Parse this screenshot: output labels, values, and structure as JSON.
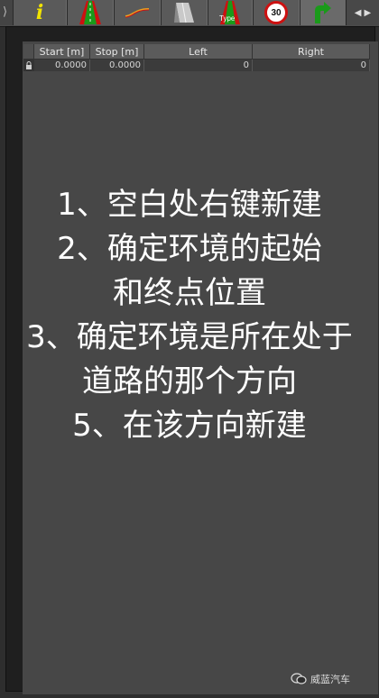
{
  "toolbar": {
    "tabs": [
      {
        "icon": "info-icon",
        "glyph": "i"
      },
      {
        "icon": "road-lane-icon"
      },
      {
        "icon": "road-curve-icon"
      },
      {
        "icon": "road-surface-icon"
      },
      {
        "icon": "road-type-icon",
        "label": "Type"
      },
      {
        "icon": "speed-limit-icon",
        "label": "30"
      },
      {
        "icon": "road-direction-icon"
      }
    ],
    "accent_red": "#cc1111",
    "accent_green": "#1a9a1a",
    "accent_yellow": "#f2e300"
  },
  "table": {
    "columns": [
      "Start [m]",
      "Stop [m]",
      "Left",
      "Right"
    ],
    "rows": [
      [
        "0.0000",
        "0.0000",
        "0",
        "0"
      ]
    ]
  },
  "instructions": [
    "1、空白处右键新建",
    "2、确定环境的起始",
    "和终点位置",
    "3、确定环境是所在处于",
    "道路的那个方向",
    "5、在该方向新建"
  ],
  "watermark": {
    "text": "威蓝汽车"
  }
}
